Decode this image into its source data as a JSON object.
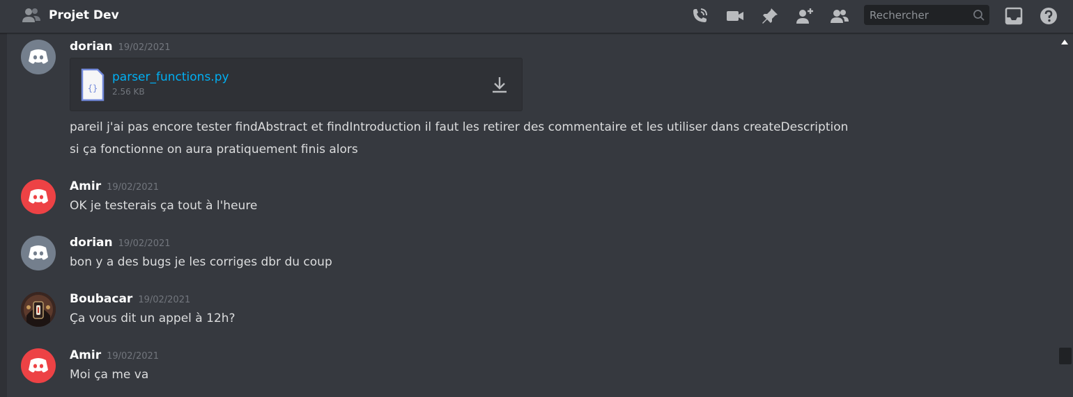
{
  "header": {
    "channel_name": "Projet Dev",
    "search_placeholder": "Rechercher"
  },
  "colors": {
    "background": "#36393f",
    "attachment_bg": "#2f3136",
    "link": "#00b0f4",
    "avatar_grey": "#747f8d",
    "avatar_red": "#ed4245"
  },
  "messages": [
    {
      "author": "dorian",
      "timestamp": "19/02/2021",
      "avatar": "discord-default-grey",
      "attachment": {
        "filename": "parser_functions.py",
        "size": "2.56 KB"
      },
      "lines": [
        "pareil j'ai pas encore tester findAbstract et findIntroduction il faut les retirer des commentaire et les utiliser dans createDescription",
        "si ça fonctionne on aura pratiquement finis alors"
      ]
    },
    {
      "author": "Amir",
      "timestamp": "19/02/2021",
      "avatar": "discord-default-red",
      "lines": [
        "OK je testerais ça tout à l'heure"
      ]
    },
    {
      "author": "dorian",
      "timestamp": "19/02/2021",
      "avatar": "discord-default-grey",
      "lines": [
        "bon y a des bugs je les corriges dbr du coup"
      ]
    },
    {
      "author": "Boubacar",
      "timestamp": "19/02/2021",
      "avatar": "custom-photo",
      "lines": [
        "Ça vous dit un appel à 12h?"
      ]
    },
    {
      "author": "Amir",
      "timestamp": "19/02/2021",
      "avatar": "discord-default-red",
      "lines": [
        "Moi ça me va"
      ]
    }
  ]
}
